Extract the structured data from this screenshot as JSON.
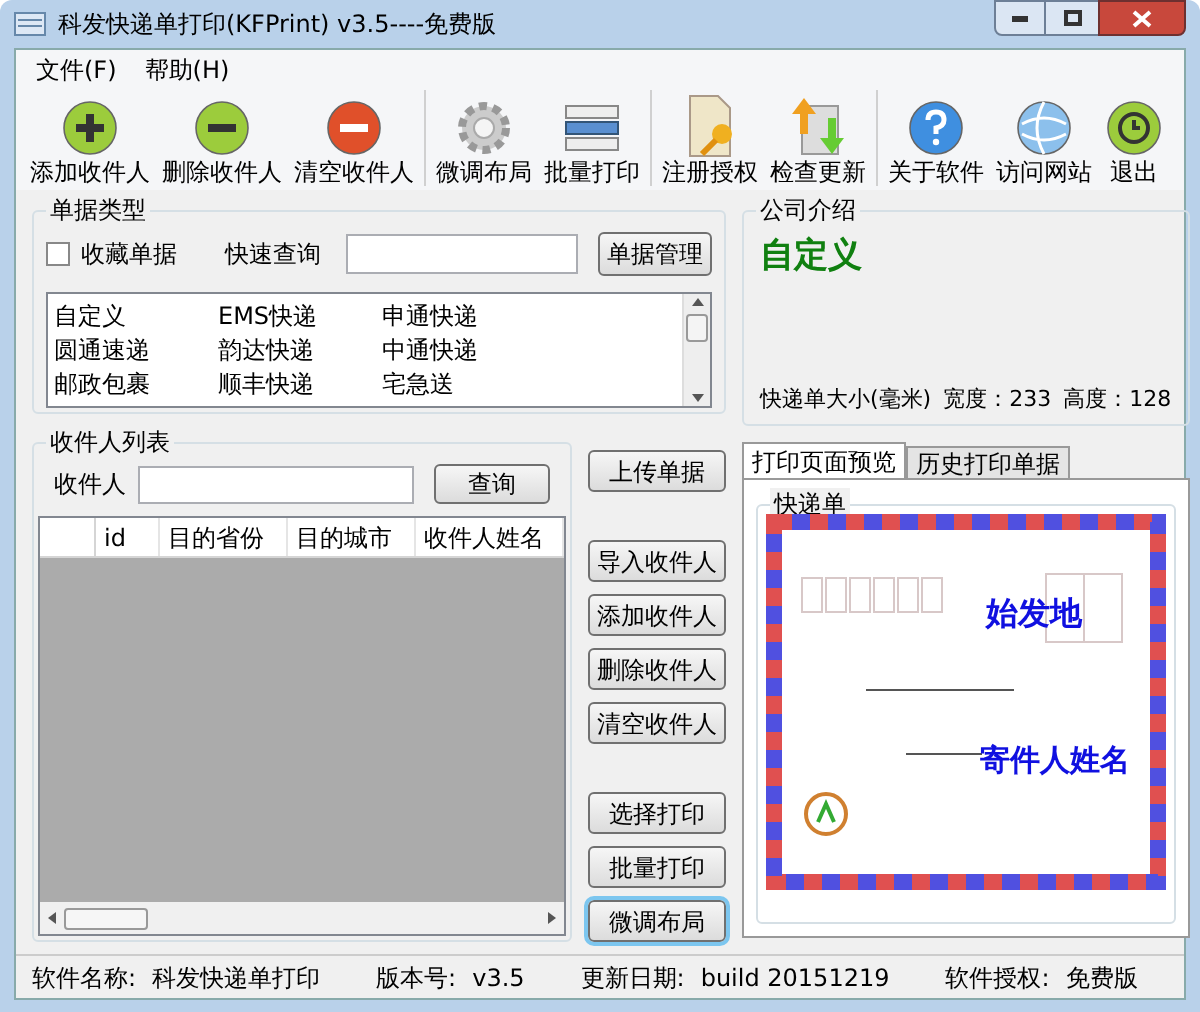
{
  "window": {
    "title": "科发快递单打印(KFPrint) v3.5----免费版"
  },
  "menu": [
    "文件(F)",
    "帮助(H)"
  ],
  "toolbar_groups": [
    [
      {
        "label": "添加收件人",
        "kind": "add"
      },
      {
        "label": "删除收件人",
        "kind": "remove"
      },
      {
        "label": "清空收件人",
        "kind": "clear"
      }
    ],
    [
      {
        "label": "微调布局",
        "kind": "gear"
      },
      {
        "label": "批量打印",
        "kind": "list"
      }
    ],
    [
      {
        "label": "注册授权",
        "kind": "key"
      },
      {
        "label": "检查更新",
        "kind": "update"
      }
    ],
    [
      {
        "label": "关于软件",
        "kind": "help"
      },
      {
        "label": "访问网站",
        "kind": "globe"
      },
      {
        "label": "退出",
        "kind": "exit"
      }
    ]
  ],
  "ticket_types": {
    "title": "单据类型",
    "favorite": {
      "label": "收藏单据",
      "checked": false
    },
    "search_label": "快速查询",
    "manage_button": "单据管理",
    "items": [
      "自定义",
      "EMS快递",
      "申通快递",
      "圆通速递",
      "韵达快递",
      "中通快递",
      "邮政包裹",
      "顺丰快递",
      "宅急送"
    ]
  },
  "company": {
    "title": "公司介绍",
    "name": "自定义",
    "size_label": "快递单大小(毫米)",
    "width": "宽度：233",
    "height": "高度：128"
  },
  "recipients": {
    "title": "收件人列表",
    "field_label": "收件人",
    "search_button": "查询",
    "columns": [
      "id",
      "目的省份",
      "目的城市",
      "收件人姓名"
    ]
  },
  "side_button_groups": [
    [
      {
        "label": "上传单据",
        "focused": false
      }
    ],
    [
      {
        "label": "导入收件人",
        "focused": false
      },
      {
        "label": "添加收件人",
        "focused": false
      },
      {
        "label": "删除收件人",
        "focused": false
      },
      {
        "label": "清空收件人",
        "focused": false
      }
    ],
    [
      {
        "label": "选择打印",
        "focused": false
      },
      {
        "label": "批量打印",
        "focused": false
      },
      {
        "label": "微调布局",
        "focused": true
      }
    ]
  ],
  "preview": {
    "tabs": [
      {
        "label": "打印页面预览",
        "selected": true
      },
      {
        "label": "历史打印单据",
        "selected": false
      }
    ],
    "group_title": "快递单",
    "origin": "始发地",
    "sender": "寄件人姓名"
  },
  "status_bar": [
    {
      "label": "软件名称:",
      "value": "科发快递单打印"
    },
    {
      "label": "版本号:",
      "value": "v3.5"
    },
    {
      "label": "更新日期:",
      "value": "build 20151219"
    },
    {
      "label": "软件授权:",
      "value": "免费版"
    }
  ]
}
